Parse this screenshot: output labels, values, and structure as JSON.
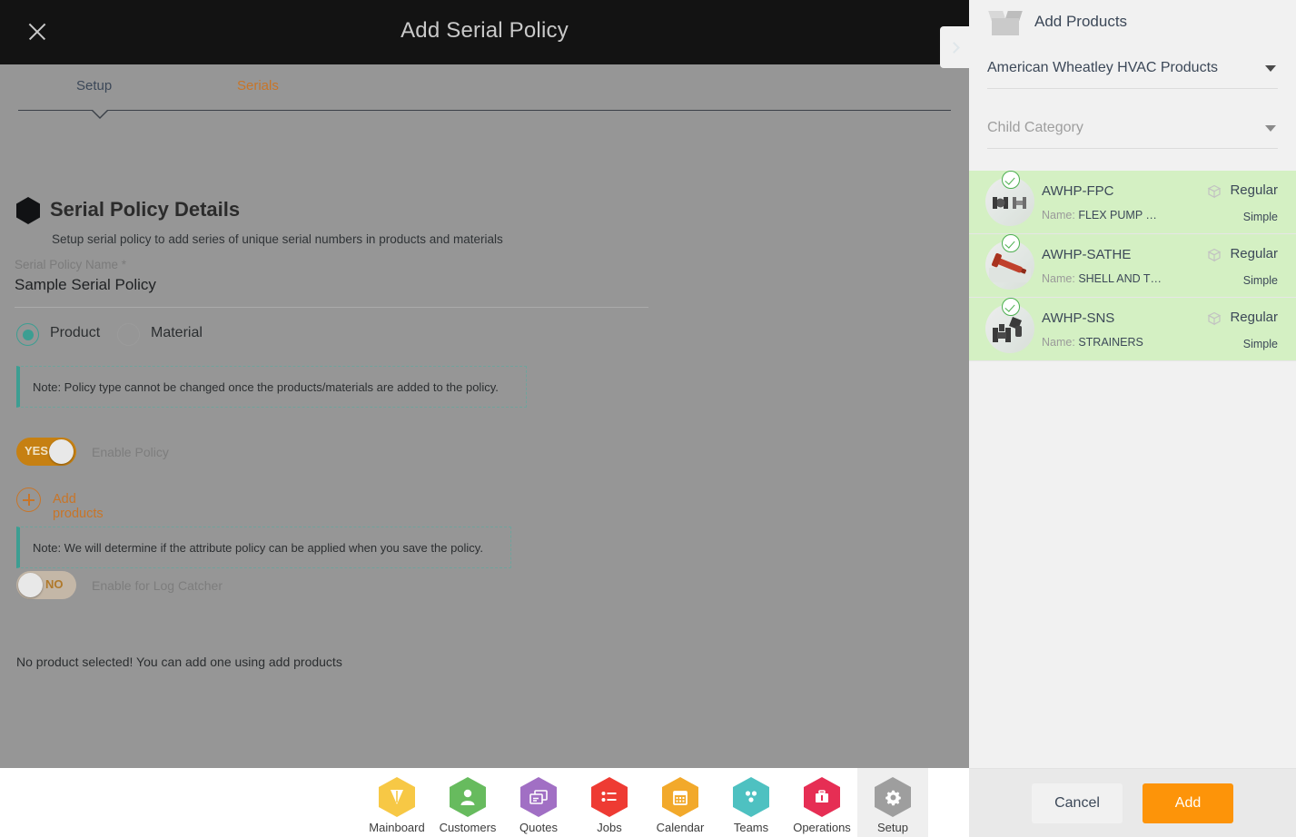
{
  "modal": {
    "title": "Add Serial Policy",
    "close_icon": "close-icon",
    "expand_icon": "chevron-right-icon",
    "tabs": [
      {
        "label": "Setup",
        "active": true
      },
      {
        "label": "Serials",
        "active": false
      }
    ],
    "section": {
      "heading": "Serial Policy Details",
      "subheading": "Setup serial policy to add series of unique serial numbers in products and materials",
      "marker_icon": "hexagon-icon"
    },
    "policy_name": {
      "label": "Serial Policy Name *",
      "value": "Sample Serial Policy",
      "placeholder": "Serial Policy Name"
    },
    "policy_type": {
      "options": [
        {
          "label": "Product",
          "selected": true
        },
        {
          "label": "Material",
          "selected": false
        }
      ]
    },
    "note_1": "Note: Policy type cannot be changed once the products/materials are added to the policy.",
    "note_2": "Note: We will determine if the attribute policy can be applied when you save the policy.",
    "enable_policy": {
      "label": "Enable Policy",
      "state": "YES",
      "on": true
    },
    "enable_log_catcher": {
      "label": "Enable for Log Catcher",
      "state": "NO",
      "on": false
    },
    "add_products_link": {
      "label": "Add products",
      "icon": "plus-circle-icon"
    },
    "empty_message": "No product selected! You can add one using add products"
  },
  "panel": {
    "title": "Add Products",
    "title_icon": "open-box-icon",
    "parent_category": {
      "value": "American Wheatley HVAC Products",
      "caret_icon": "chevron-down-icon"
    },
    "child_category": {
      "placeholder": "Child Category",
      "value": "",
      "caret_icon": "chevron-down-icon"
    },
    "products": [
      {
        "sku": "AWHP-FPC",
        "name_label": "Name:",
        "name": "FLEX PUMP …",
        "type": "Regular",
        "kind": "Simple",
        "selected": true,
        "thumb_icon": "flex-pump-connector-thumbnail",
        "type_icon": "cube-icon",
        "check_icon": "check-circle-icon"
      },
      {
        "sku": "AWHP-SATHE",
        "name_label": "Name:",
        "name": "SHELL AND T…",
        "type": "Regular",
        "kind": "Simple",
        "selected": true,
        "thumb_icon": "shell-and-tube-thumbnail",
        "type_icon": "cube-icon",
        "check_icon": "check-circle-icon"
      },
      {
        "sku": "AWHP-SNS",
        "name_label": "Name:",
        "name": "STRAINERS",
        "type": "Regular",
        "kind": "Simple",
        "selected": true,
        "thumb_icon": "strainers-thumbnail",
        "type_icon": "cube-icon",
        "check_icon": "check-circle-icon"
      }
    ],
    "buttons": {
      "cancel": "Cancel",
      "add": "Add"
    }
  },
  "bottom_nav": {
    "items": [
      {
        "label": "Mainboard",
        "icon": "mainboard-icon",
        "color": "#f7c845",
        "active": false
      },
      {
        "label": "Customers",
        "icon": "customers-icon",
        "color": "#67bb5e",
        "active": false
      },
      {
        "label": "Quotes",
        "icon": "quotes-icon",
        "color": "#a16fc4",
        "active": false
      },
      {
        "label": "Jobs",
        "icon": "jobs-icon",
        "color": "#ee3b33",
        "active": false
      },
      {
        "label": "Calendar",
        "icon": "calendar-icon",
        "color": "#f2a92b",
        "active": false
      },
      {
        "label": "Teams",
        "icon": "teams-icon",
        "color": "#4ec1c1",
        "active": false
      },
      {
        "label": "Operations",
        "icon": "operations-icon",
        "color": "#e62e54",
        "active": false
      },
      {
        "label": "Setup",
        "icon": "gear-icon",
        "color": "#9e9e9e",
        "active": true
      }
    ],
    "avatar_icon": "user-avatar"
  },
  "colors": {
    "accent_orange": "#fd9409",
    "tab_orange": "#c87528",
    "teal": "#3c9e92",
    "selected_row_green": "#d4f0c3",
    "overlay_gray": "#969696",
    "header_black": "#131313",
    "panel_bg": "#f1f1f1"
  }
}
